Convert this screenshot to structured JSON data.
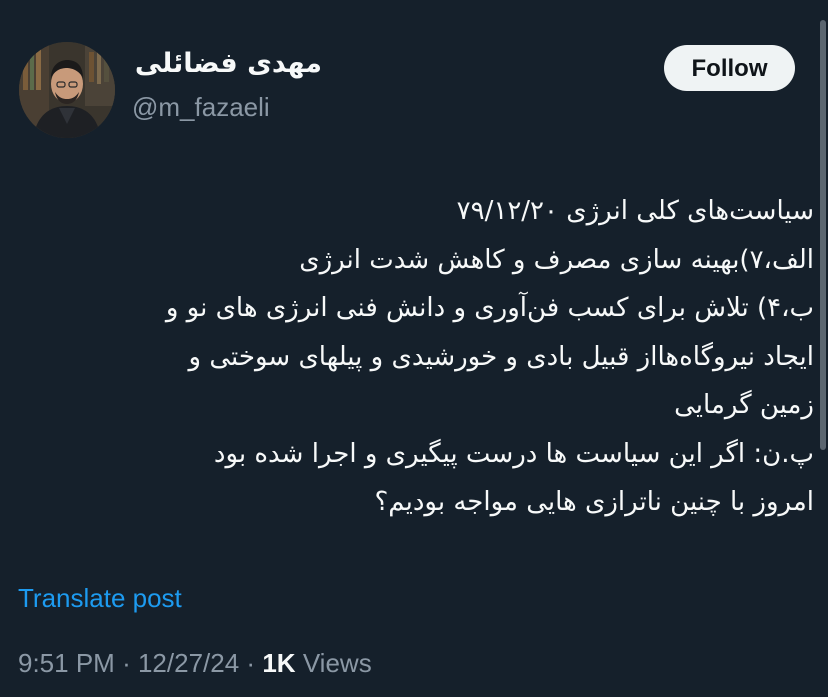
{
  "header": {
    "display_name": "مهدی فضائلی",
    "handle": "@m_fazaeli",
    "follow_label": "Follow"
  },
  "tweet": {
    "lines": [
      "سیاست‌های کلی انرژی ۷۹/۱۲/۲۰",
      "الف،۷)بهینه سازی مصرف و کاهش شدت انرژی",
      "ب،۴) تلاش برای کسب فن‌آوری و دانش فنی انرژی های نو و",
      "ایجاد نیروگاه‌هااز قبیل بادی و خورشیدی و پیلهای سوختی و",
      "زمین گرمایی",
      "پ.ن: اگر این سیاست ها درست پیگیری و اجرا شده بود",
      "امروز با چنین ناترازی هایی مواجه بودیم؟"
    ]
  },
  "translate_label": "Translate post",
  "meta": {
    "time": "9:51 PM",
    "separator": "·",
    "date": "12/27/24",
    "views_count": "1K",
    "views_label": "Views"
  },
  "colors": {
    "background": "#15202b",
    "text": "#f7f9f9",
    "secondary": "#8b98a5",
    "link": "#1d9bf0",
    "button_bg": "#eff3f4"
  }
}
